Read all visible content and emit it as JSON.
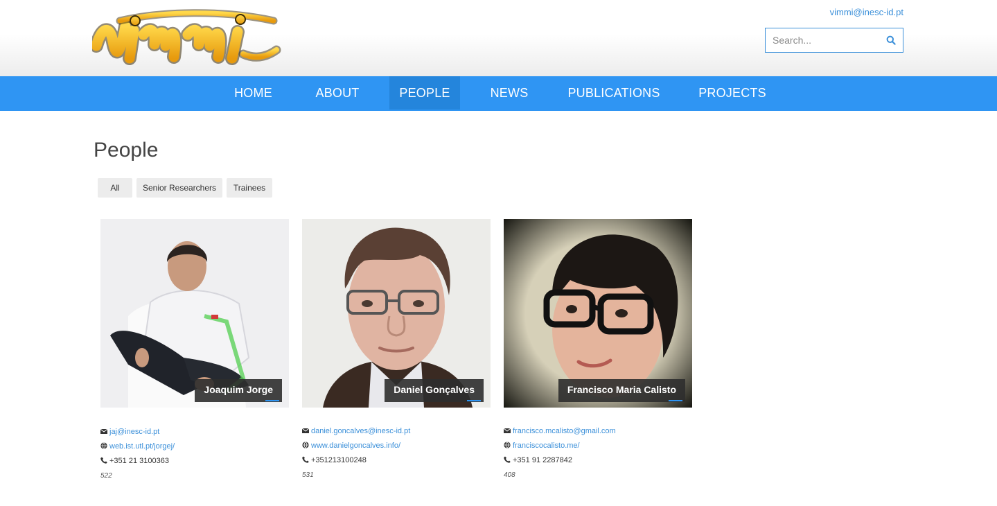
{
  "header": {
    "logo_text": "vimmi",
    "contact_email": "vimmi@inesc-id.pt",
    "search": {
      "placeholder": "Search...",
      "value": ""
    }
  },
  "nav": {
    "items": [
      {
        "label": "HOME",
        "active": false
      },
      {
        "label": "ABOUT",
        "active": false
      },
      {
        "label": "PEOPLE",
        "active": true
      },
      {
        "label": "NEWS",
        "active": false
      },
      {
        "label": "PUBLICATIONS",
        "active": false
      },
      {
        "label": "PROJECTS",
        "active": false
      }
    ]
  },
  "page": {
    "title": "People",
    "filters": [
      "All",
      "Senior Researchers",
      "Trainees"
    ]
  },
  "people": [
    {
      "name": "Joaquim Jorge",
      "email": "jaj@inesc-id.pt",
      "website": "web.ist.utl.pt/jorgej/",
      "phone": "+351 21 3100363",
      "room": "522"
    },
    {
      "name": "Daniel Gonçalves",
      "email": "daniel.goncalves@inesc-id.pt",
      "website": "www.danielgoncalves.info/",
      "phone": "+351213100248",
      "room": "531"
    },
    {
      "name": "Francisco Maria Calisto",
      "email": "francisco.mcalisto@gmail.com",
      "website": "franciscocalisto.me/",
      "phone": "+351 91 2287842",
      "room": "408"
    }
  ],
  "colors": {
    "nav_bg": "#2f95f3",
    "nav_active_bg": "#2485dc",
    "link": "#3a8fd9",
    "logo_yellow": "#f5b51c"
  },
  "icons": {
    "email": "envelope-icon",
    "website": "globe-icon",
    "phone": "phone-icon",
    "search": "search-icon"
  }
}
